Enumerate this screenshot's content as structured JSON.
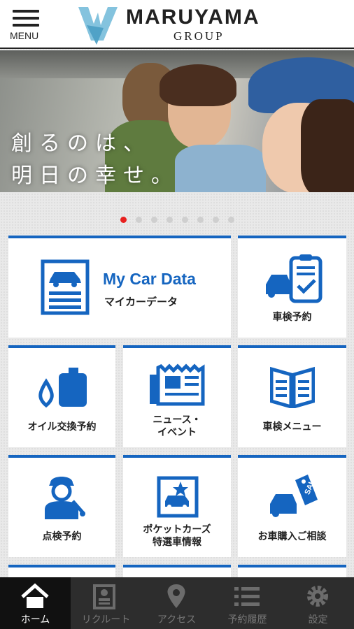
{
  "header": {
    "menu_label": "MENU",
    "brand_name": "MARUYAMA",
    "brand_sub": "GROUP"
  },
  "hero": {
    "line1": "創るのは、",
    "line2": "明日の幸せ。",
    "slide_count": 8,
    "active_slide": 1
  },
  "tiles": {
    "my_car_title": "My Car Data",
    "my_car_sub": "マイカーデータ",
    "shaken_reserve": "車検予約",
    "oil_reserve": "オイル交換予約",
    "news_line1": "ニュース・",
    "news_line2": "イベント",
    "shaken_menu": "車検メニュー",
    "inspection_reserve": "点検予約",
    "pocket_line1": "ポケットカーズ",
    "pocket_line2": "特選車情報",
    "purchase_consult": "お車購入ご相談"
  },
  "nav": {
    "home": "ホーム",
    "recruit": "リクルート",
    "access": "アクセス",
    "history": "予約履歴",
    "settings": "設定"
  },
  "colors": {
    "accent": "#1565c0",
    "logo_blue": "#6fb9d8",
    "active_dot": "#e8201f",
    "nav_bg": "#2d2d2d"
  }
}
